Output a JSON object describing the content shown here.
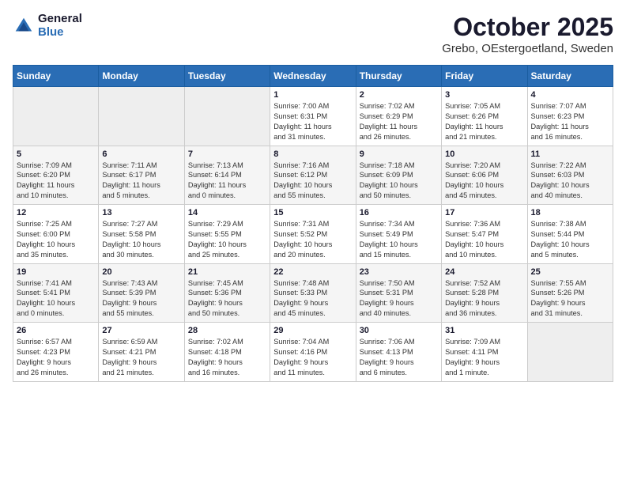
{
  "logo": {
    "general": "General",
    "blue": "Blue"
  },
  "title": "October 2025",
  "subtitle": "Grebo, OEstergoetland, Sweden",
  "days_of_week": [
    "Sunday",
    "Monday",
    "Tuesday",
    "Wednesday",
    "Thursday",
    "Friday",
    "Saturday"
  ],
  "weeks": [
    [
      {
        "day": "",
        "info": ""
      },
      {
        "day": "",
        "info": ""
      },
      {
        "day": "",
        "info": ""
      },
      {
        "day": "1",
        "info": "Sunrise: 7:00 AM\nSunset: 6:31 PM\nDaylight: 11 hours\nand 31 minutes."
      },
      {
        "day": "2",
        "info": "Sunrise: 7:02 AM\nSunset: 6:29 PM\nDaylight: 11 hours\nand 26 minutes."
      },
      {
        "day": "3",
        "info": "Sunrise: 7:05 AM\nSunset: 6:26 PM\nDaylight: 11 hours\nand 21 minutes."
      },
      {
        "day": "4",
        "info": "Sunrise: 7:07 AM\nSunset: 6:23 PM\nDaylight: 11 hours\nand 16 minutes."
      }
    ],
    [
      {
        "day": "5",
        "info": "Sunrise: 7:09 AM\nSunset: 6:20 PM\nDaylight: 11 hours\nand 10 minutes."
      },
      {
        "day": "6",
        "info": "Sunrise: 7:11 AM\nSunset: 6:17 PM\nDaylight: 11 hours\nand 5 minutes."
      },
      {
        "day": "7",
        "info": "Sunrise: 7:13 AM\nSunset: 6:14 PM\nDaylight: 11 hours\nand 0 minutes."
      },
      {
        "day": "8",
        "info": "Sunrise: 7:16 AM\nSunset: 6:12 PM\nDaylight: 10 hours\nand 55 minutes."
      },
      {
        "day": "9",
        "info": "Sunrise: 7:18 AM\nSunset: 6:09 PM\nDaylight: 10 hours\nand 50 minutes."
      },
      {
        "day": "10",
        "info": "Sunrise: 7:20 AM\nSunset: 6:06 PM\nDaylight: 10 hours\nand 45 minutes."
      },
      {
        "day": "11",
        "info": "Sunrise: 7:22 AM\nSunset: 6:03 PM\nDaylight: 10 hours\nand 40 minutes."
      }
    ],
    [
      {
        "day": "12",
        "info": "Sunrise: 7:25 AM\nSunset: 6:00 PM\nDaylight: 10 hours\nand 35 minutes."
      },
      {
        "day": "13",
        "info": "Sunrise: 7:27 AM\nSunset: 5:58 PM\nDaylight: 10 hours\nand 30 minutes."
      },
      {
        "day": "14",
        "info": "Sunrise: 7:29 AM\nSunset: 5:55 PM\nDaylight: 10 hours\nand 25 minutes."
      },
      {
        "day": "15",
        "info": "Sunrise: 7:31 AM\nSunset: 5:52 PM\nDaylight: 10 hours\nand 20 minutes."
      },
      {
        "day": "16",
        "info": "Sunrise: 7:34 AM\nSunset: 5:49 PM\nDaylight: 10 hours\nand 15 minutes."
      },
      {
        "day": "17",
        "info": "Sunrise: 7:36 AM\nSunset: 5:47 PM\nDaylight: 10 hours\nand 10 minutes."
      },
      {
        "day": "18",
        "info": "Sunrise: 7:38 AM\nSunset: 5:44 PM\nDaylight: 10 hours\nand 5 minutes."
      }
    ],
    [
      {
        "day": "19",
        "info": "Sunrise: 7:41 AM\nSunset: 5:41 PM\nDaylight: 10 hours\nand 0 minutes."
      },
      {
        "day": "20",
        "info": "Sunrise: 7:43 AM\nSunset: 5:39 PM\nDaylight: 9 hours\nand 55 minutes."
      },
      {
        "day": "21",
        "info": "Sunrise: 7:45 AM\nSunset: 5:36 PM\nDaylight: 9 hours\nand 50 minutes."
      },
      {
        "day": "22",
        "info": "Sunrise: 7:48 AM\nSunset: 5:33 PM\nDaylight: 9 hours\nand 45 minutes."
      },
      {
        "day": "23",
        "info": "Sunrise: 7:50 AM\nSunset: 5:31 PM\nDaylight: 9 hours\nand 40 minutes."
      },
      {
        "day": "24",
        "info": "Sunrise: 7:52 AM\nSunset: 5:28 PM\nDaylight: 9 hours\nand 36 minutes."
      },
      {
        "day": "25",
        "info": "Sunrise: 7:55 AM\nSunset: 5:26 PM\nDaylight: 9 hours\nand 31 minutes."
      }
    ],
    [
      {
        "day": "26",
        "info": "Sunrise: 6:57 AM\nSunset: 4:23 PM\nDaylight: 9 hours\nand 26 minutes."
      },
      {
        "day": "27",
        "info": "Sunrise: 6:59 AM\nSunset: 4:21 PM\nDaylight: 9 hours\nand 21 minutes."
      },
      {
        "day": "28",
        "info": "Sunrise: 7:02 AM\nSunset: 4:18 PM\nDaylight: 9 hours\nand 16 minutes."
      },
      {
        "day": "29",
        "info": "Sunrise: 7:04 AM\nSunset: 4:16 PM\nDaylight: 9 hours\nand 11 minutes."
      },
      {
        "day": "30",
        "info": "Sunrise: 7:06 AM\nSunset: 4:13 PM\nDaylight: 9 hours\nand 6 minutes."
      },
      {
        "day": "31",
        "info": "Sunrise: 7:09 AM\nSunset: 4:11 PM\nDaylight: 9 hours\nand 1 minute."
      },
      {
        "day": "",
        "info": ""
      }
    ]
  ]
}
